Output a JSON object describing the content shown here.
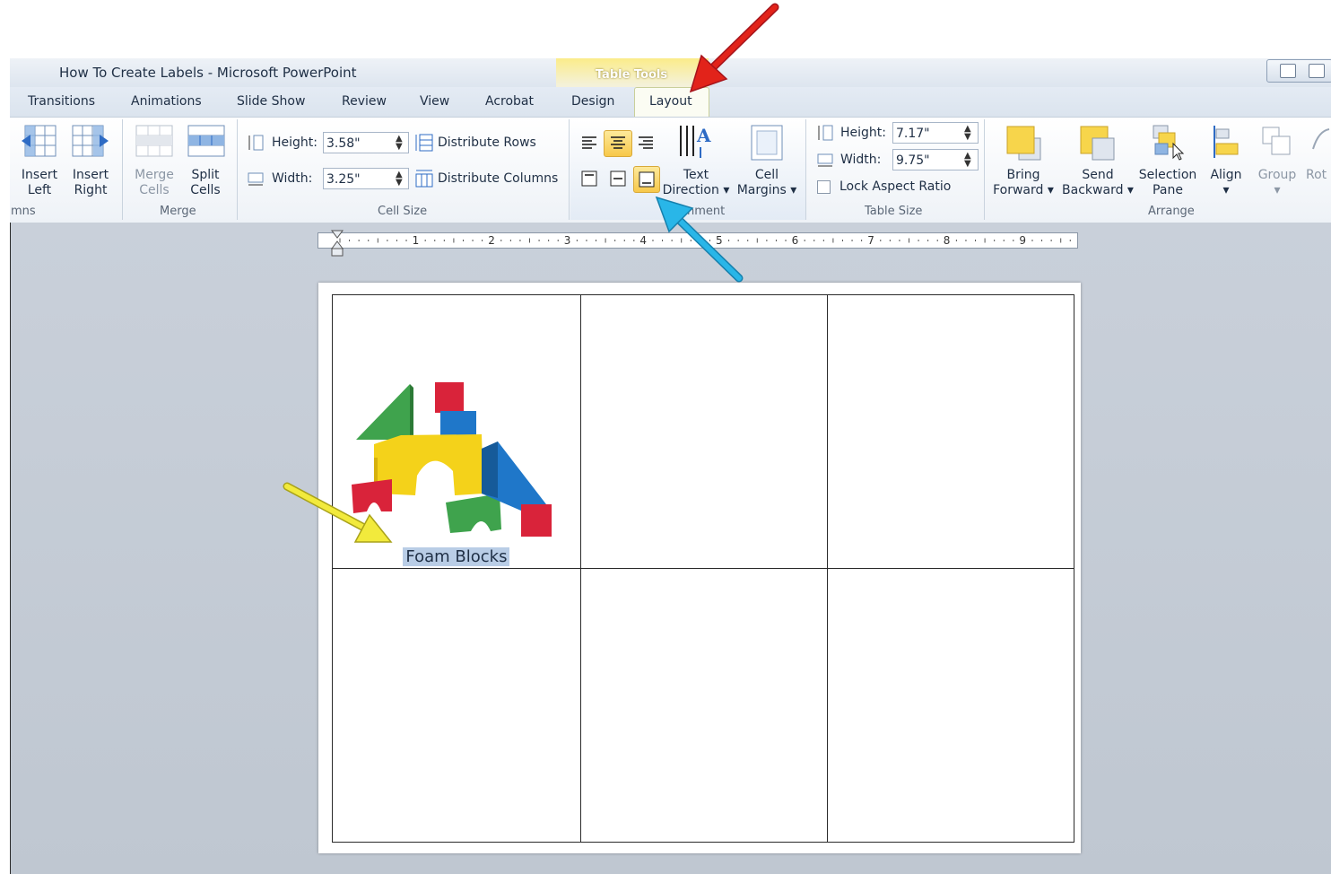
{
  "window": {
    "title": "How To Create Labels  -  Microsoft PowerPoint"
  },
  "contextual_tab_group": "Table Tools",
  "tabs": [
    "Transitions",
    "Animations",
    "Slide Show",
    "Review",
    "View",
    "Acrobat",
    "Design",
    "Layout"
  ],
  "active_tab": "Layout",
  "ribbon": {
    "columns_group": {
      "label": "mns",
      "insert_left_l1": "Insert",
      "insert_left_l2": "Left",
      "insert_right_l1": "Insert",
      "insert_right_l2": "Right"
    },
    "merge_group": {
      "label": "Merge",
      "merge_l1": "Merge",
      "merge_l2": "Cells",
      "split_l1": "Split",
      "split_l2": "Cells"
    },
    "cell_size_group": {
      "label": "Cell Size",
      "height_label": "Height:",
      "height_value": "3.58\"",
      "width_label": "Width:",
      "width_value": "3.25\"",
      "distribute_rows": "Distribute Rows",
      "distribute_columns": "Distribute Columns"
    },
    "alignment_group": {
      "label": "nment",
      "text_direction_l1": "Text",
      "text_direction_l2": "Direction ▾",
      "cell_margins_l1": "Cell",
      "cell_margins_l2": "Margins ▾"
    },
    "table_size_group": {
      "label": "Table Size",
      "height_label": "Height:",
      "height_value": "7.17\"",
      "width_label": "Width:",
      "width_value": "9.75\"",
      "lock_aspect": "Lock Aspect Ratio",
      "lock_aspect_checked": false
    },
    "arrange_group": {
      "label": "Arrange",
      "bring_l1": "Bring",
      "bring_l2": "Forward ▾",
      "send_l1": "Send",
      "send_l2": "Backward ▾",
      "selection_l1": "Selection",
      "selection_l2": "Pane",
      "align_l1": "Align",
      "align_l2": "▾",
      "group_l1": "Group",
      "group_l2": "▾",
      "rotate_l1": "Rot"
    }
  },
  "ruler": {
    "numbers": [
      "1",
      "2",
      "3",
      "4",
      "5",
      "6",
      "7",
      "8",
      "9"
    ]
  },
  "slide": {
    "cell_caption": "Foam Blocks",
    "rows": 2,
    "cols": 3
  },
  "colors": {
    "accent_yellow": "#f7d54b",
    "red_arrow": "#e2231a",
    "blue_arrow": "#29b6e8",
    "yellow_arrow": "#f2ea3c"
  }
}
